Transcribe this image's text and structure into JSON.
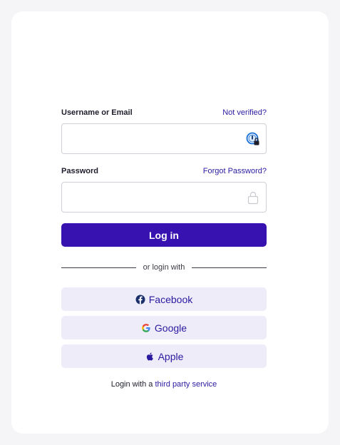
{
  "username": {
    "label": "Username or Email",
    "link": "Not verified?",
    "value": "",
    "placeholder": "",
    "icon": "password-manager-icon"
  },
  "password": {
    "label": "Password",
    "link": "Forgot Password?",
    "value": "",
    "placeholder": "",
    "icon": "lock-icon"
  },
  "login_button": "Log in",
  "divider_text": "or login with",
  "social": [
    {
      "label": "Facebook",
      "icon": "facebook-icon"
    },
    {
      "label": "Google",
      "icon": "google-icon"
    },
    {
      "label": "Apple",
      "icon": "apple-icon"
    }
  ],
  "footer": {
    "prefix": "Login with a",
    "link": "third party service"
  },
  "colors": {
    "accent": "#3712b0",
    "link": "#2a1aa0",
    "social_bg": "#eeecf9",
    "page_bg": "#f5f5f8",
    "card_bg": "#ffffff"
  }
}
